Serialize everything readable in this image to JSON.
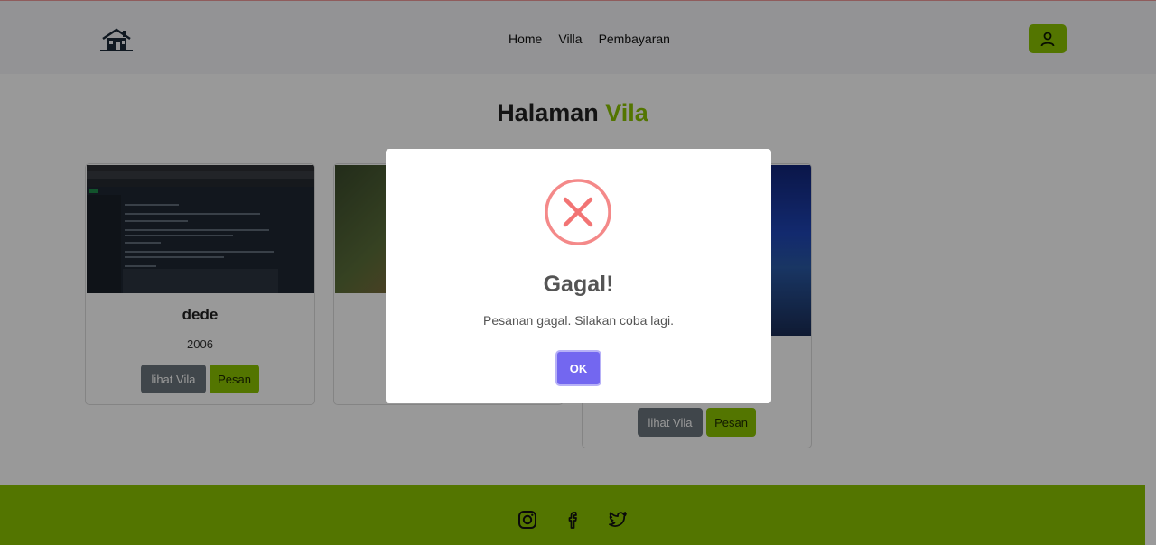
{
  "navbar": {
    "links": [
      "Home",
      "Villa",
      "Pembayaran"
    ]
  },
  "page": {
    "title_main": "Halaman",
    "title_accent": "Vila"
  },
  "cards": [
    {
      "name": "dede",
      "year": "2006",
      "view_label": "lihat Vila",
      "book_label": "Pesan"
    },
    {
      "name": "",
      "year": "",
      "view_label": "",
      "book_label": ""
    },
    {
      "name": "",
      "year": "",
      "view_label": "lihat Vila",
      "book_label": "Pesan"
    }
  ],
  "modal": {
    "title": "Gagal!",
    "message": "Pesanan gagal. Silakan coba lagi.",
    "ok_label": "OK"
  },
  "footer": {
    "icons": [
      "instagram-icon",
      "facebook-icon",
      "twitter-icon"
    ]
  },
  "colors": {
    "accent": "#8bc300",
    "error": "#f27474",
    "confirm": "#7367f0",
    "gray_button": "#6c757d"
  }
}
